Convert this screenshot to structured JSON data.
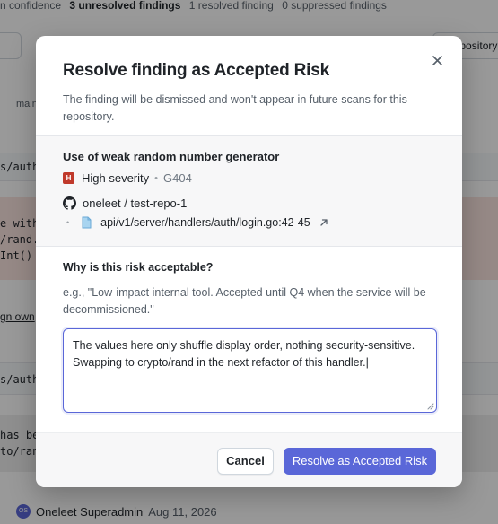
{
  "background": {
    "topbar": {
      "confidence": "n confidence",
      "unresolved": "3 unresolved findings",
      "resolved": "1 resolved finding",
      "suppressed": "0 suppressed findings"
    },
    "right_button": "Repository",
    "branch": "main",
    "path1": "s/auth/l",
    "code1": [
      "e with",
      "/rand.",
      "Int()"
    ],
    "link": "gn own",
    "path2": "s/auth/l",
    "code2": [
      "has be",
      "to/ran"
    ],
    "footer": {
      "avatar": "OS",
      "user": "Oneleet Superadmin",
      "date": "Aug 11, 2026"
    }
  },
  "modal": {
    "title": "Resolve finding as Accepted Risk",
    "subtitle": "The finding will be dismissed and won't appear in future scans for this repository.",
    "finding": {
      "title": "Use of weak random number generator",
      "severity_icon": "H",
      "severity": "High severity",
      "rule_id": "G404",
      "repo": "oneleet / test-repo-1",
      "file": "api/v1/server/handlers/auth/login.go:42-45"
    },
    "question": "Why is this risk acceptable?",
    "hint": "e.g., \"Low-impact internal tool. Accepted until Q4 when the service will be decommissioned.\"",
    "textarea_value": "The values here only shuffle display order, nothing security-sensitive. Swapping to crypto/rand in the next refactor of this handler.",
    "cancel_label": "Cancel",
    "submit_label": "Resolve as Accepted Risk"
  },
  "colors": {
    "primary": "#5a67d8",
    "severity_high": "#c0392b",
    "overlay": "rgba(0,0,0,0.40)"
  },
  "icons": {
    "close": "close-icon",
    "severity": "severity-high-icon",
    "repo": "github-icon",
    "file": "file-icon",
    "external": "external-link-icon",
    "resize": "resize-grip-icon"
  }
}
